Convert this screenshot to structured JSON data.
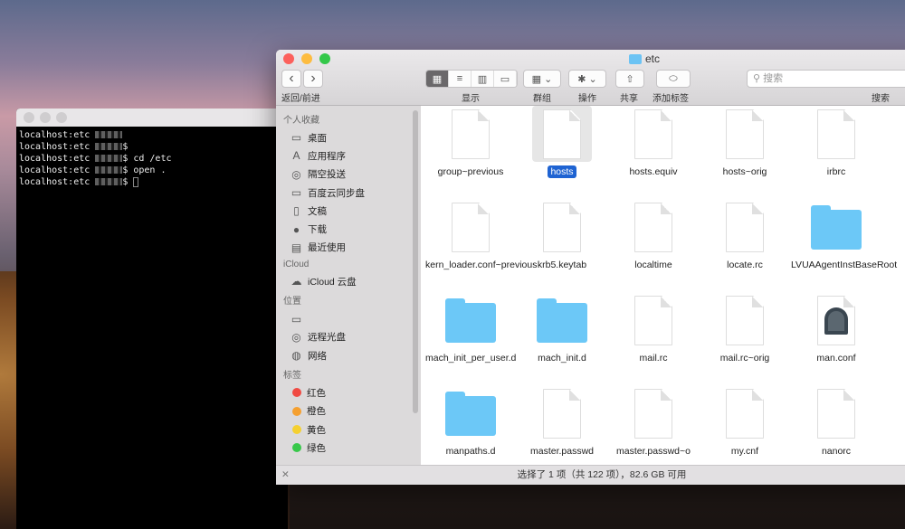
{
  "terminal": {
    "lines": [
      {
        "prompt": "localhost:etc",
        "cmd": ""
      },
      {
        "prompt": "localhost:etc",
        "cmd": "$"
      },
      {
        "prompt": "localhost:etc",
        "cmd": "$ cd /etc"
      },
      {
        "prompt": "localhost:etc",
        "cmd": "$ open ."
      },
      {
        "prompt": "localhost:etc",
        "cmd": "$"
      }
    ]
  },
  "finder": {
    "title": "etc",
    "toolbar": {
      "back": "‹",
      "forward": "›",
      "back_forward_label": "返回/前进",
      "view_label": "显示",
      "group_label": "群组",
      "action_label": "操作",
      "share_label": "共享",
      "tag_label": "添加标签",
      "search_placeholder": "搜索",
      "search_label": "搜索"
    },
    "sidebar": {
      "favorites_heading": "个人收藏",
      "favorites": [
        {
          "label": "桌面",
          "icon": "▭"
        },
        {
          "label": "应用程序",
          "icon": "A"
        },
        {
          "label": "隔空投送",
          "icon": "◎"
        },
        {
          "label": "百度云同步盘",
          "icon": "▭"
        },
        {
          "label": "文稿",
          "icon": "▯"
        },
        {
          "label": "下载",
          "icon": "●"
        },
        {
          "label": "最近使用",
          "icon": "▤"
        }
      ],
      "icloud_heading": "iCloud",
      "icloud": [
        {
          "label": "iCloud 云盘",
          "icon": "☁"
        }
      ],
      "locations_heading": "位置",
      "locations": [
        {
          "label": "",
          "icon": "▭"
        },
        {
          "label": "远程光盘",
          "icon": "◎"
        },
        {
          "label": "网络",
          "icon": "◍"
        }
      ],
      "tags_heading": "标签",
      "tags": [
        {
          "label": "红色",
          "color": "#f04a43"
        },
        {
          "label": "橙色",
          "color": "#f5a030"
        },
        {
          "label": "黄色",
          "color": "#f5d030"
        },
        {
          "label": "绿色",
          "color": "#38c84a"
        }
      ]
    },
    "files": [
      {
        "name": "group~previous",
        "kind": "doc"
      },
      {
        "name": "hosts",
        "kind": "doc",
        "selected": true
      },
      {
        "name": "hosts.equiv",
        "kind": "doc"
      },
      {
        "name": "hosts~orig",
        "kind": "doc"
      },
      {
        "name": "irbrc",
        "kind": "doc"
      },
      {
        "name": "ker",
        "kind": "doc"
      },
      {
        "name": "kern_loader.conf~previous",
        "kind": "doc"
      },
      {
        "name": "krb5.keytab",
        "kind": "doc"
      },
      {
        "name": "localtime",
        "kind": "doc"
      },
      {
        "name": "locate.rc",
        "kind": "doc"
      },
      {
        "name": "LVUAAgentInstBaseRoot",
        "kind": "folder"
      },
      {
        "name": "mac",
        "kind": "doc"
      },
      {
        "name": "mach_init_per_user.d",
        "kind": "folder"
      },
      {
        "name": "mach_init.d",
        "kind": "folder"
      },
      {
        "name": "mail.rc",
        "kind": "doc"
      },
      {
        "name": "mail.rc~orig",
        "kind": "doc"
      },
      {
        "name": "man.conf",
        "kind": "man"
      },
      {
        "name": "",
        "kind": "none"
      },
      {
        "name": "manpaths.d",
        "kind": "folder"
      },
      {
        "name": "master.passwd",
        "kind": "doc"
      },
      {
        "name": "master.passwd~o",
        "kind": "doc"
      },
      {
        "name": "my.cnf",
        "kind": "doc"
      },
      {
        "name": "nanorc",
        "kind": "doc"
      },
      {
        "name": "",
        "kind": "none"
      }
    ],
    "status": "选择了 1 项（共 122 项），82.6 GB 可用"
  }
}
